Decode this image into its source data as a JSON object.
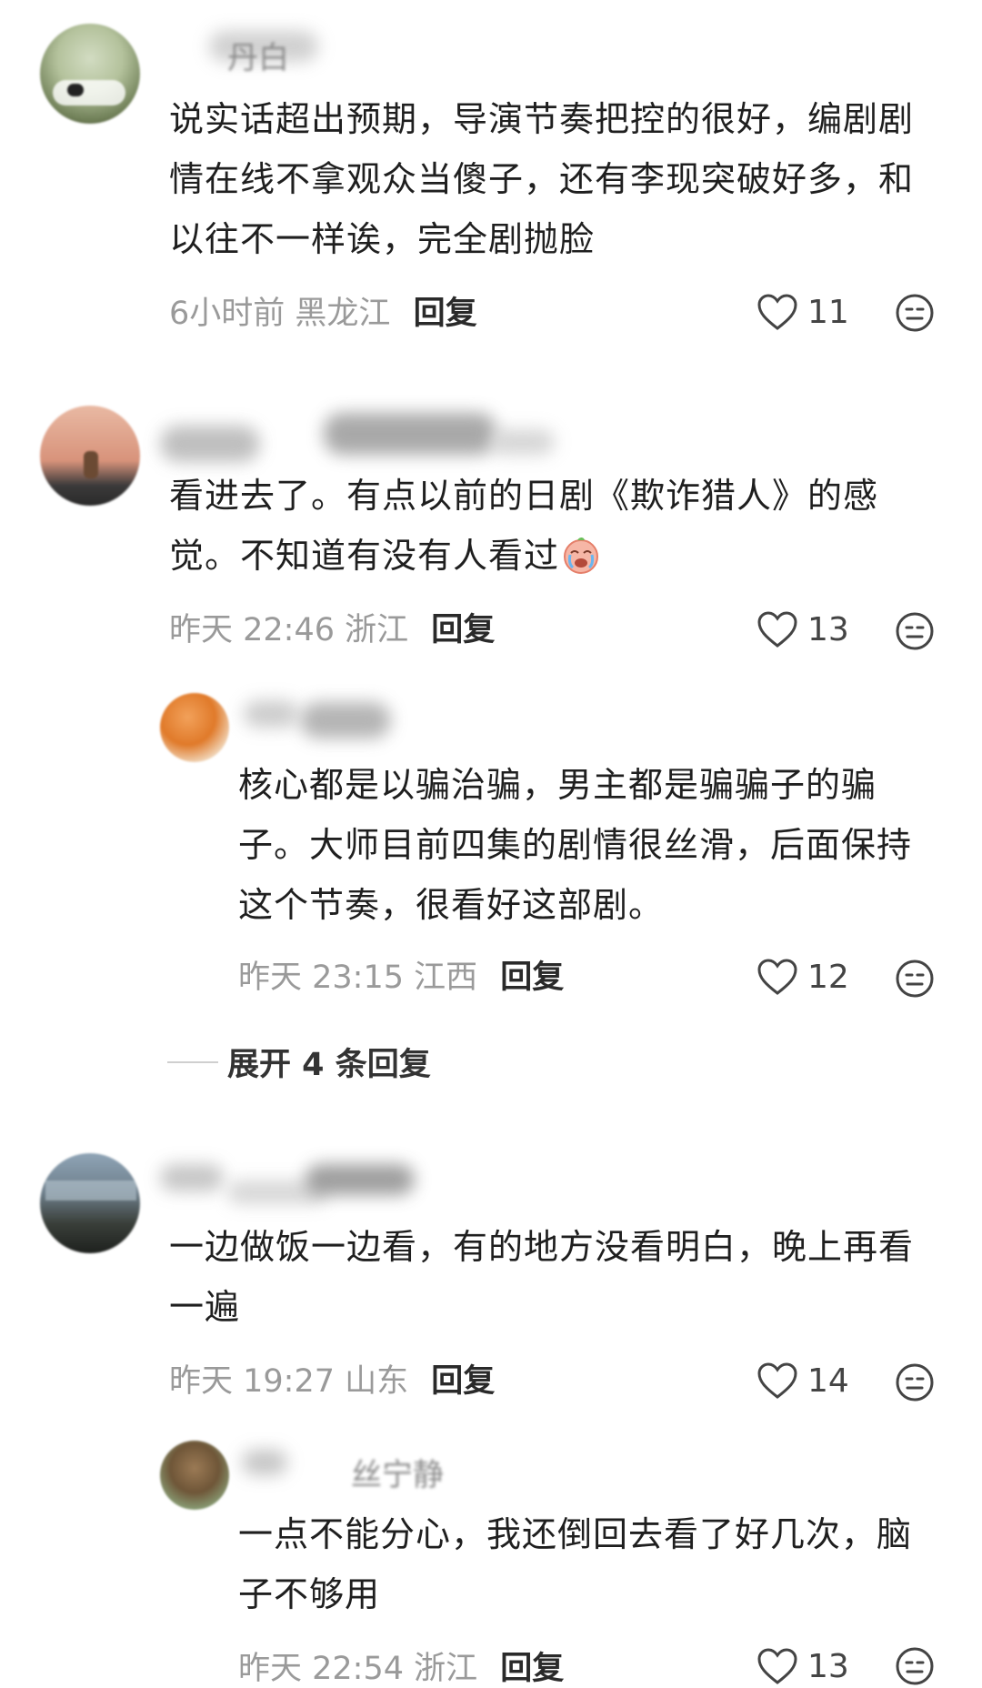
{
  "comments": [
    {
      "id": "c1",
      "username": "丹白",
      "text": "说实话超出预期，导演节奏把控的很好，编剧剧情在线不拿观众当傻子，还有李现突破好多，和以往不一样诶，完全剧抛脸",
      "time": "6小时前",
      "location": "黑龙江",
      "reply_label": "回复",
      "likes": "11"
    },
    {
      "id": "c2",
      "username": "",
      "text": "看进去了。有点以前的日剧《欺诈猎人》的感觉。不知道有没有人看过",
      "time": "昨天 22:46",
      "location": "浙江",
      "reply_label": "回复",
      "likes": "13",
      "trailing_emoji": "crying-face-emoji"
    },
    {
      "id": "c2r1",
      "username": "",
      "text": "核心都是以骗治骗，男主都是骗骗子的骗子。大师目前四集的剧情很丝滑，后面保持这个节奏，很看好这部剧。",
      "time": "昨天 23:15",
      "location": "江西",
      "reply_label": "回复",
      "likes": "12"
    },
    {
      "id": "c3",
      "username": "",
      "text": "一边做饭一边看，有的地方没看明白，晚上再看一遍",
      "time": "昨天 19:27",
      "location": "山东",
      "reply_label": "回复",
      "likes": "14"
    },
    {
      "id": "c3r1",
      "username": "丝宁静",
      "text": "一点不能分心，我还倒回去看了好几次，脑子不够用",
      "time": "昨天 22:54",
      "location": "浙江",
      "reply_label": "回复",
      "likes": "13"
    }
  ],
  "expand_replies": "展开 4 条回复",
  "icons": {
    "like": "heart-outline-icon",
    "dislike": "neutral-face-icon"
  },
  "colors": {
    "text": "#1f1f1f",
    "meta": "#9a9a9a",
    "reply": "#2a2a2a"
  }
}
